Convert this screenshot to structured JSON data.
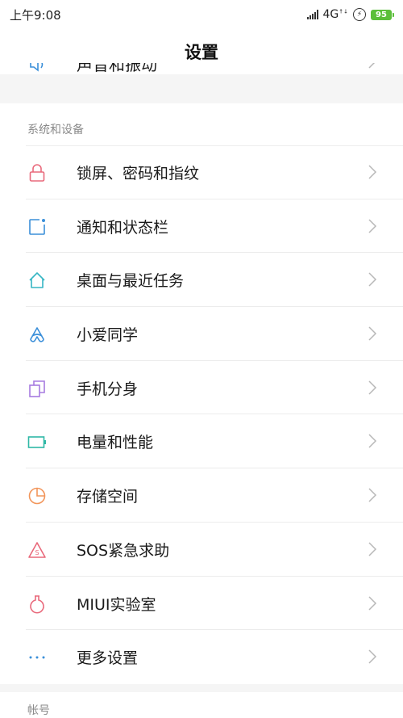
{
  "status_bar": {
    "time": "上午9:08",
    "network": "4G",
    "battery": "95"
  },
  "header": {
    "title": "设置"
  },
  "partial_item": {
    "label": "声音和振动",
    "icon": "speaker-icon"
  },
  "sections": [
    {
      "title": "系统和设备",
      "items": [
        {
          "label": "锁屏、密码和指纹",
          "icon": "lock-icon",
          "color": "#e96a7c"
        },
        {
          "label": "通知和状态栏",
          "icon": "notification-icon",
          "color": "#3b8fd9"
        },
        {
          "label": "桌面与最近任务",
          "icon": "home-icon",
          "color": "#36b6c4"
        },
        {
          "label": "小爱同学",
          "icon": "xiaoai-icon",
          "color": "#3b8fd9"
        },
        {
          "label": "手机分身",
          "icon": "second-space-icon",
          "color": "#a77be0"
        },
        {
          "label": "电量和性能",
          "icon": "battery-icon",
          "color": "#2fb8a6"
        },
        {
          "label": "存储空间",
          "icon": "storage-pie-icon",
          "color": "#f2955a"
        },
        {
          "label": "SOS紧急求助",
          "icon": "sos-icon",
          "color": "#e96a7c"
        },
        {
          "label": "MIUI实验室",
          "icon": "lab-flask-icon",
          "color": "#e96a7c"
        },
        {
          "label": "更多设置",
          "icon": "more-dots-icon",
          "color": "#3b8fd9"
        }
      ]
    },
    {
      "title": "帐号"
    }
  ]
}
